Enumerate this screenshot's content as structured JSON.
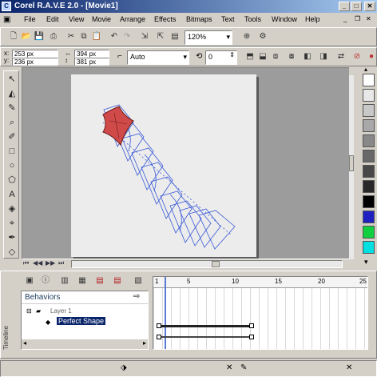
{
  "title_bar": {
    "title": "Corel R.A.V.E 2.0 - [Movie1]",
    "icon_letter": "C",
    "minimize": "_",
    "maximize": "□",
    "close": "✕"
  },
  "menu": {
    "file": "File",
    "edit": "Edit",
    "view": "View",
    "movie": "Movie",
    "arrange": "Arrange",
    "effects": "Effects",
    "bitmaps": "Bitmaps",
    "text": "Text",
    "tools": "Tools",
    "window": "Window",
    "help": "Help"
  },
  "toolbar": {
    "zoom_value": "120%"
  },
  "property_bar": {
    "x_pos": "253 px",
    "y_pos": "236 px",
    "width": "394 px",
    "height": "381 px",
    "mode_value": "Auto",
    "angle_value": "0"
  },
  "timeline": {
    "panel_title": "Behaviors",
    "layer_name": "Layer 1",
    "selected_object": "Perfect Shape",
    "ticks": [
      "1",
      "5",
      "10",
      "15",
      "20",
      "25"
    ],
    "side_label": "Timeline"
  },
  "palette_colors": [
    "#ffffff",
    "#e8e8e8",
    "#c8c8c8",
    "#a8a8a8",
    "#888888",
    "#686868",
    "#484848",
    "#282828",
    "#000000",
    "#2020c0",
    "#10d040",
    "#00e0e0"
  ],
  "shape_color": "#d04a4a",
  "outline_color": "#3a5ad8"
}
